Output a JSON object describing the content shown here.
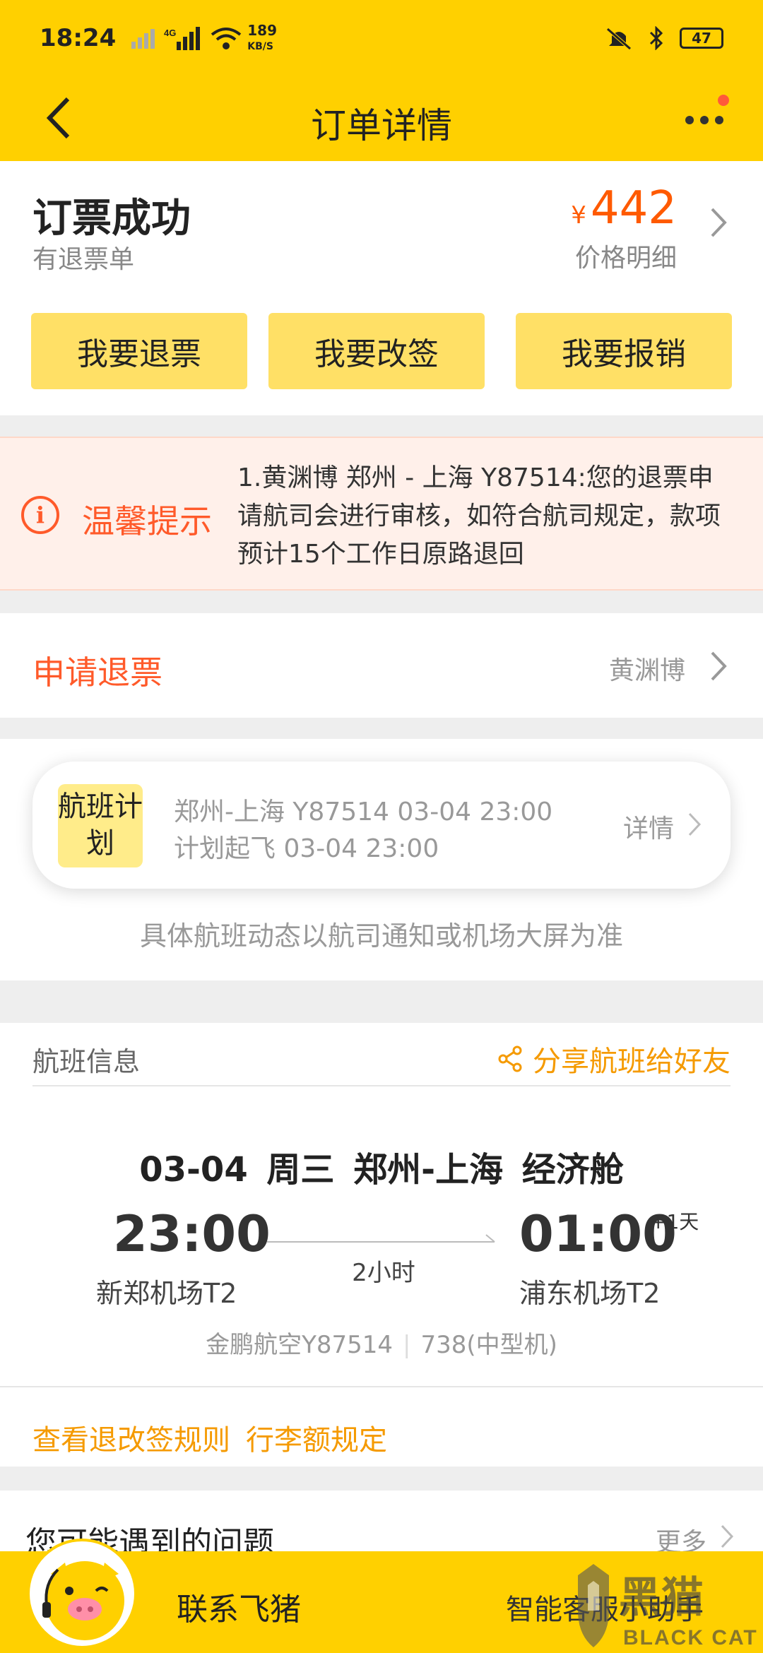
{
  "status_bar": {
    "time": "18:24",
    "net_speed": "189",
    "net_unit": "KB/S",
    "battery": "47"
  },
  "header": {
    "title": "订单详情"
  },
  "order": {
    "status": "订票成功",
    "sub_status": "有退票单",
    "currency": "¥",
    "price": "442",
    "price_detail": "价格明细",
    "actions": [
      "我要退票",
      "我要改签",
      "我要报销"
    ]
  },
  "tip": {
    "title": "温馨提示",
    "text": "1.黄渊博 郑州 - 上海 Y87514:您的退票申请航司会进行审核，如符合航司规定，款项预计15个工作日原路退回"
  },
  "refund": {
    "title": "申请退票",
    "passenger": "黄渊博"
  },
  "flight_plan": {
    "badge": "航班计划",
    "line1": "郑州-上海 Y87514 03-04 23:00",
    "line2": "计划起飞 03-04 23:00",
    "detail": "详情",
    "note": "具体航班动态以航司通知或机场大屏为准"
  },
  "flight_info": {
    "heading": "航班信息",
    "share": "分享航班给好友",
    "route": "03-04  周三  郑州-上海  经济舱",
    "dep_time": "23:00",
    "arr_time": "01:00",
    "plus_day": "+1天",
    "duration": "2小时",
    "dep_airport": "新郑机场T2",
    "arr_airport": "浦东机场T2",
    "flight_no": "金鹏航空Y87514",
    "aircraft": "738(中型机)",
    "links": [
      "查看退改签规则",
      "行李额规定"
    ]
  },
  "faq": {
    "title": "您可能遇到的问题",
    "more": "更多"
  },
  "bottom": {
    "contact": "联系飞猪",
    "assistant": "智能客服小助手"
  },
  "watermark": {
    "cn": "黑猫",
    "en": "BLACK CAT"
  },
  "colors": {
    "brand_yellow": "#ffd000",
    "accent_orange": "#ff5a2a",
    "link_orange": "#f59a00"
  }
}
